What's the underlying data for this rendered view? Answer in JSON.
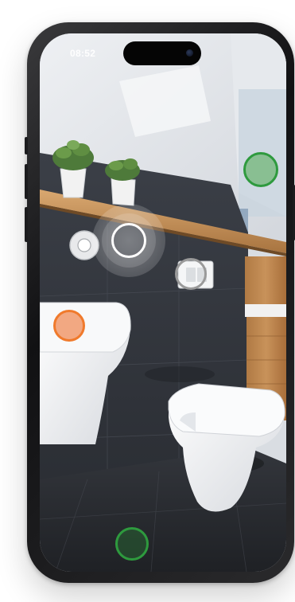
{
  "status_bar": {
    "time": "08:52"
  },
  "colors": {
    "hotspot_green": "#2e9a3e",
    "hotspot_orange": "#f07a2c",
    "hotspot_white": "#ffffff",
    "hotspot_grey": "#9a9a9a"
  },
  "hotspots": [
    {
      "name": "hotspot-wall-green",
      "color": "green"
    },
    {
      "name": "hotspot-flush-plate",
      "color": "white"
    },
    {
      "name": "hotspot-flush-button",
      "color": "grey"
    },
    {
      "name": "hotspot-toilet-left",
      "color": "orange"
    },
    {
      "name": "hotspot-floor-green",
      "color": "green"
    }
  ]
}
